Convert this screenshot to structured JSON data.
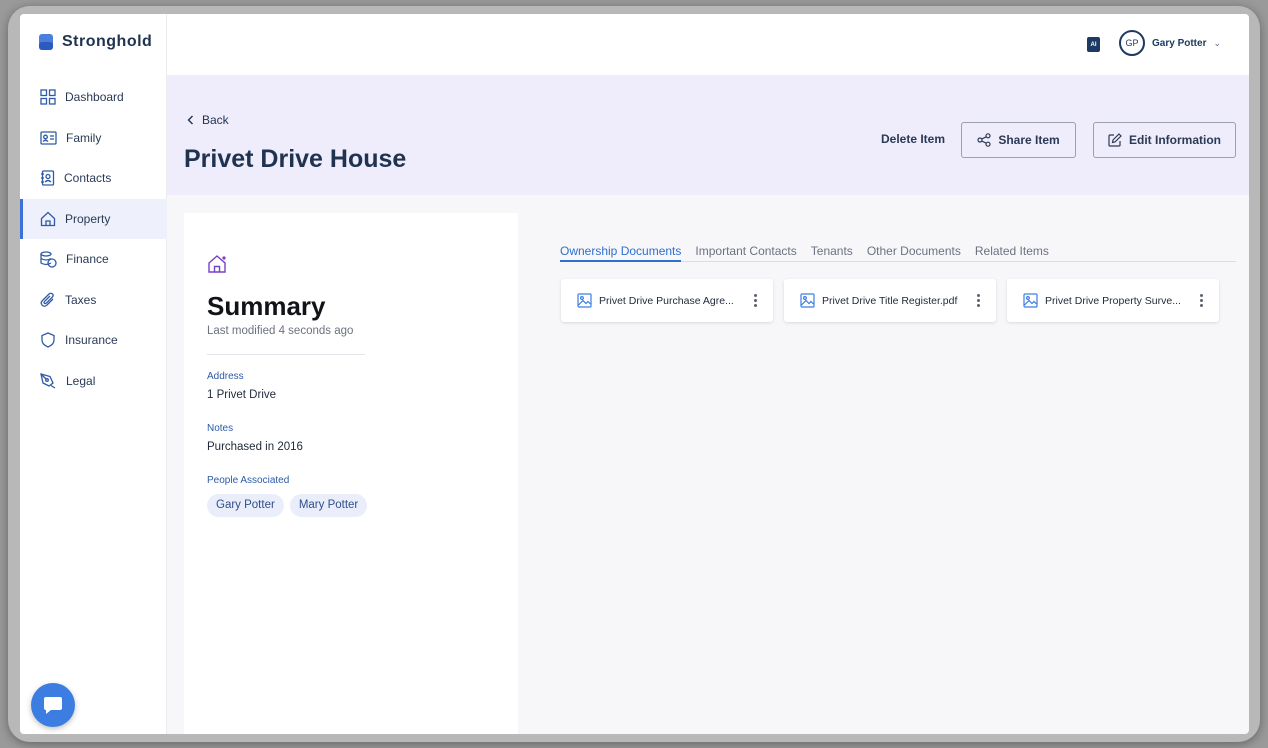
{
  "app": {
    "brand": "Stronghold"
  },
  "sidebar": {
    "items": [
      {
        "label": "Dashboard",
        "icon": "grid-icon"
      },
      {
        "label": "Family",
        "icon": "id-card-icon"
      },
      {
        "label": "Contacts",
        "icon": "address-book-icon"
      },
      {
        "label": "Property",
        "icon": "house-icon",
        "active": true
      },
      {
        "label": "Finance",
        "icon": "coins-icon"
      },
      {
        "label": "Taxes",
        "icon": "paperclip-icon"
      },
      {
        "label": "Insurance",
        "icon": "shield-icon"
      },
      {
        "label": "Legal",
        "icon": "pen-nib-icon"
      }
    ]
  },
  "topbar": {
    "ai_badge": "AI",
    "user": {
      "initials": "GP",
      "name": "Gary Potter"
    }
  },
  "header": {
    "back_label": "Back",
    "title": "Privet Drive House",
    "delete_label": "Delete Item",
    "share_label": "Share Item",
    "edit_label": "Edit Information"
  },
  "summary": {
    "title": "Summary",
    "modified": "Last modified 4 seconds ago",
    "address_label": "Address",
    "address_value": "1 Privet Drive",
    "notes_label": "Notes",
    "notes_value": "Purchased in 2016",
    "people_label": "People Associated",
    "people": [
      "Gary Potter",
      "Mary Potter"
    ]
  },
  "tabs": [
    {
      "label": "Ownership Documents",
      "active": true
    },
    {
      "label": "Important Contacts"
    },
    {
      "label": "Tenants"
    },
    {
      "label": "Other Documents"
    },
    {
      "label": "Related Items"
    }
  ],
  "documents": [
    {
      "name": "Privet Drive Purchase Agre..."
    },
    {
      "name": "Privet Drive Title Register.pdf"
    },
    {
      "name": "Privet Drive Property Surve..."
    }
  ],
  "colors": {
    "accent": "#2e6fd0",
    "header_band": "#efecfb",
    "title": "#1f3350"
  }
}
